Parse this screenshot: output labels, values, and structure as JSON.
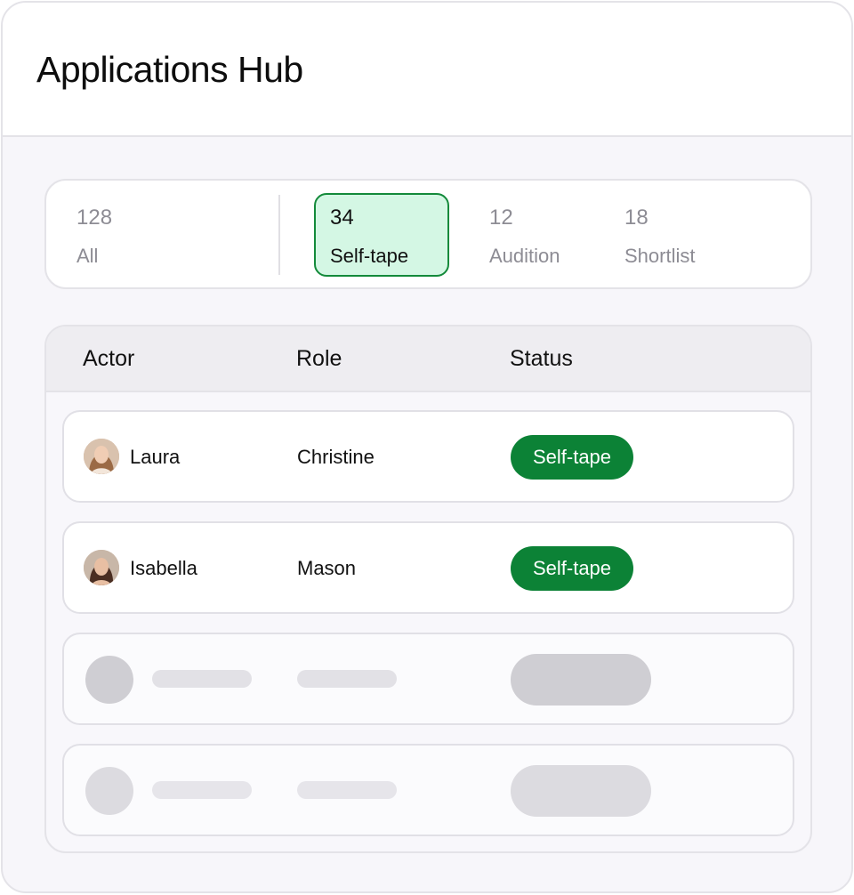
{
  "header": {
    "title": "Applications Hub"
  },
  "filters": [
    {
      "count": "128",
      "label": "All"
    },
    {
      "count": "34",
      "label": "Self-tape",
      "active": true
    },
    {
      "count": "12",
      "label": "Audition"
    },
    {
      "count": "18",
      "label": "Shortlist"
    }
  ],
  "table": {
    "columns": [
      "Actor",
      "Role",
      "Status"
    ],
    "rows": [
      {
        "actor": "Laura",
        "role": "Christine",
        "status": "Self-tape"
      },
      {
        "actor": "Isabella",
        "role": "Mason",
        "status": "Self-tape"
      }
    ],
    "placeholder_rows": 2
  },
  "colors": {
    "accent": "#0c8236",
    "active_filter_bg": "#d4f7e4",
    "page_bg": "#f7f6fa"
  },
  "icons": {
    "avatar_1": "person-photo-avatar",
    "avatar_2": "person-photo-avatar"
  }
}
